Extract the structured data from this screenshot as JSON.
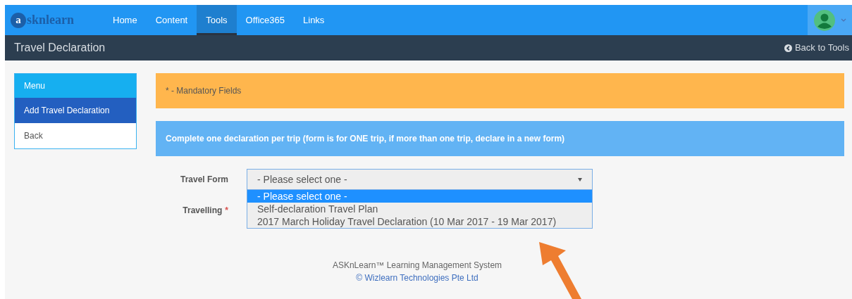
{
  "logo": {
    "initial": "a",
    "rest": "sknlearn"
  },
  "nav": [
    {
      "label": "Home",
      "selected": false
    },
    {
      "label": "Content",
      "selected": false
    },
    {
      "label": "Tools",
      "selected": true
    },
    {
      "label": "Office365",
      "selected": false
    },
    {
      "label": "Links",
      "selected": false
    }
  ],
  "page_title": "Travel Declaration",
  "back_link": "Back to Tools",
  "sidebar": {
    "title": "Menu",
    "items": [
      {
        "label": "Add Travel Declaration",
        "selected": true
      },
      {
        "label": "Back",
        "selected": false
      }
    ]
  },
  "notice": "* - Mandatory Fields",
  "info": "Complete one declaration per trip (form is for ONE trip, if more than one trip, declare in a new form)",
  "form": [
    {
      "label": "Travel Form",
      "kind": "select",
      "value": "- Please select one -",
      "options": [
        {
          "label": "- Please select one -",
          "selected": true
        },
        {
          "label": "Self-declaration Travel Plan",
          "selected": false
        },
        {
          "label": "2017 March Holiday Travel Declaration (10 Mar 2017 - 19 Mar 2017)",
          "selected": false
        }
      ]
    },
    {
      "label": "Travelling",
      "required_mark": "*",
      "kind": "hidden"
    }
  ],
  "footer": {
    "line": "ASKnLearn™ Learning Management System",
    "copyright": "© Wizlearn Technologies Pte Ltd"
  }
}
